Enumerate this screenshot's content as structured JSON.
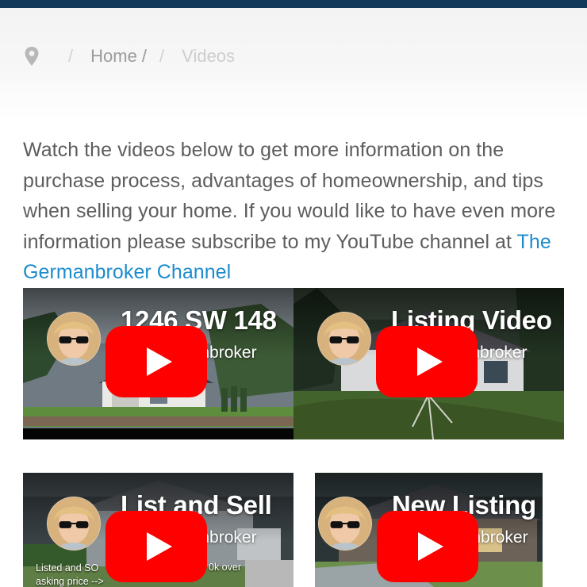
{
  "breadcrumb": {
    "icon": "map-pin-icon",
    "separator": "/",
    "home": "Home /",
    "current": "Videos"
  },
  "intro": {
    "text": "Watch the videos below to get more information on the purchase process, advantages of homeownership, and tips when selling your home. If you would like to have even more information please subscribe to my YouTube channel at ",
    "link_text": "The Germanbroker Channel"
  },
  "videos": [
    {
      "title": "1246 SW 148",
      "channel": "TheGermanbroker"
    },
    {
      "title": "Listing Video",
      "channel": "TheGermanbroker"
    },
    {
      "title": "List and Sell",
      "channel": "TheGermanbroker",
      "overlay_left": "Listed and SO\nasking price -->",
      "overlay_right": "0k over"
    },
    {
      "title": "New Listing",
      "channel": "TheGermanbroker"
    }
  ],
  "colors": {
    "topbar": "#12385a",
    "link": "#1d8ccc",
    "play_button": "#ff0000"
  }
}
